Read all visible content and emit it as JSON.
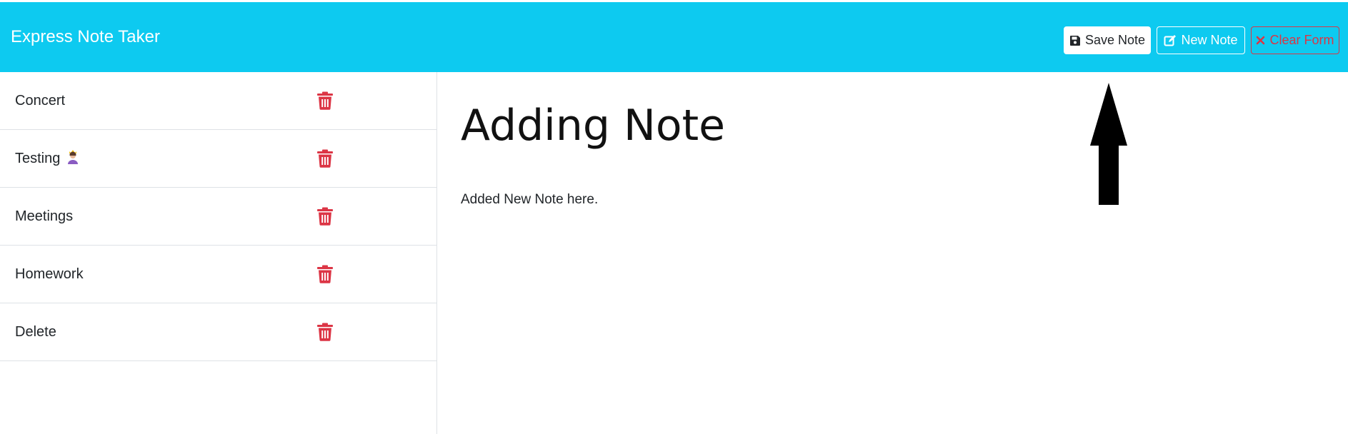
{
  "app": {
    "brand": "Express Note Taker"
  },
  "toolbar": {
    "save_label": "Save Note",
    "new_label": "New Note",
    "clear_label": "Clear Form"
  },
  "sidebar": {
    "notes": [
      {
        "title": "Concert"
      },
      {
        "title": "Testing",
        "emoji": "woman-with-crown-emoji"
      },
      {
        "title": "Meetings"
      },
      {
        "title": "Homework"
      },
      {
        "title": "Delete"
      }
    ]
  },
  "editor": {
    "title": "Adding Note",
    "body": "Added New Note here."
  },
  "colors": {
    "navbar": "#0dcaf0",
    "delete": "#dc3545",
    "border": "#dee2e6"
  },
  "icons": {
    "save": "floppy-disk-icon",
    "new": "edit-pencil-icon",
    "clear": "x-mark-icon",
    "delete": "trash-icon"
  }
}
